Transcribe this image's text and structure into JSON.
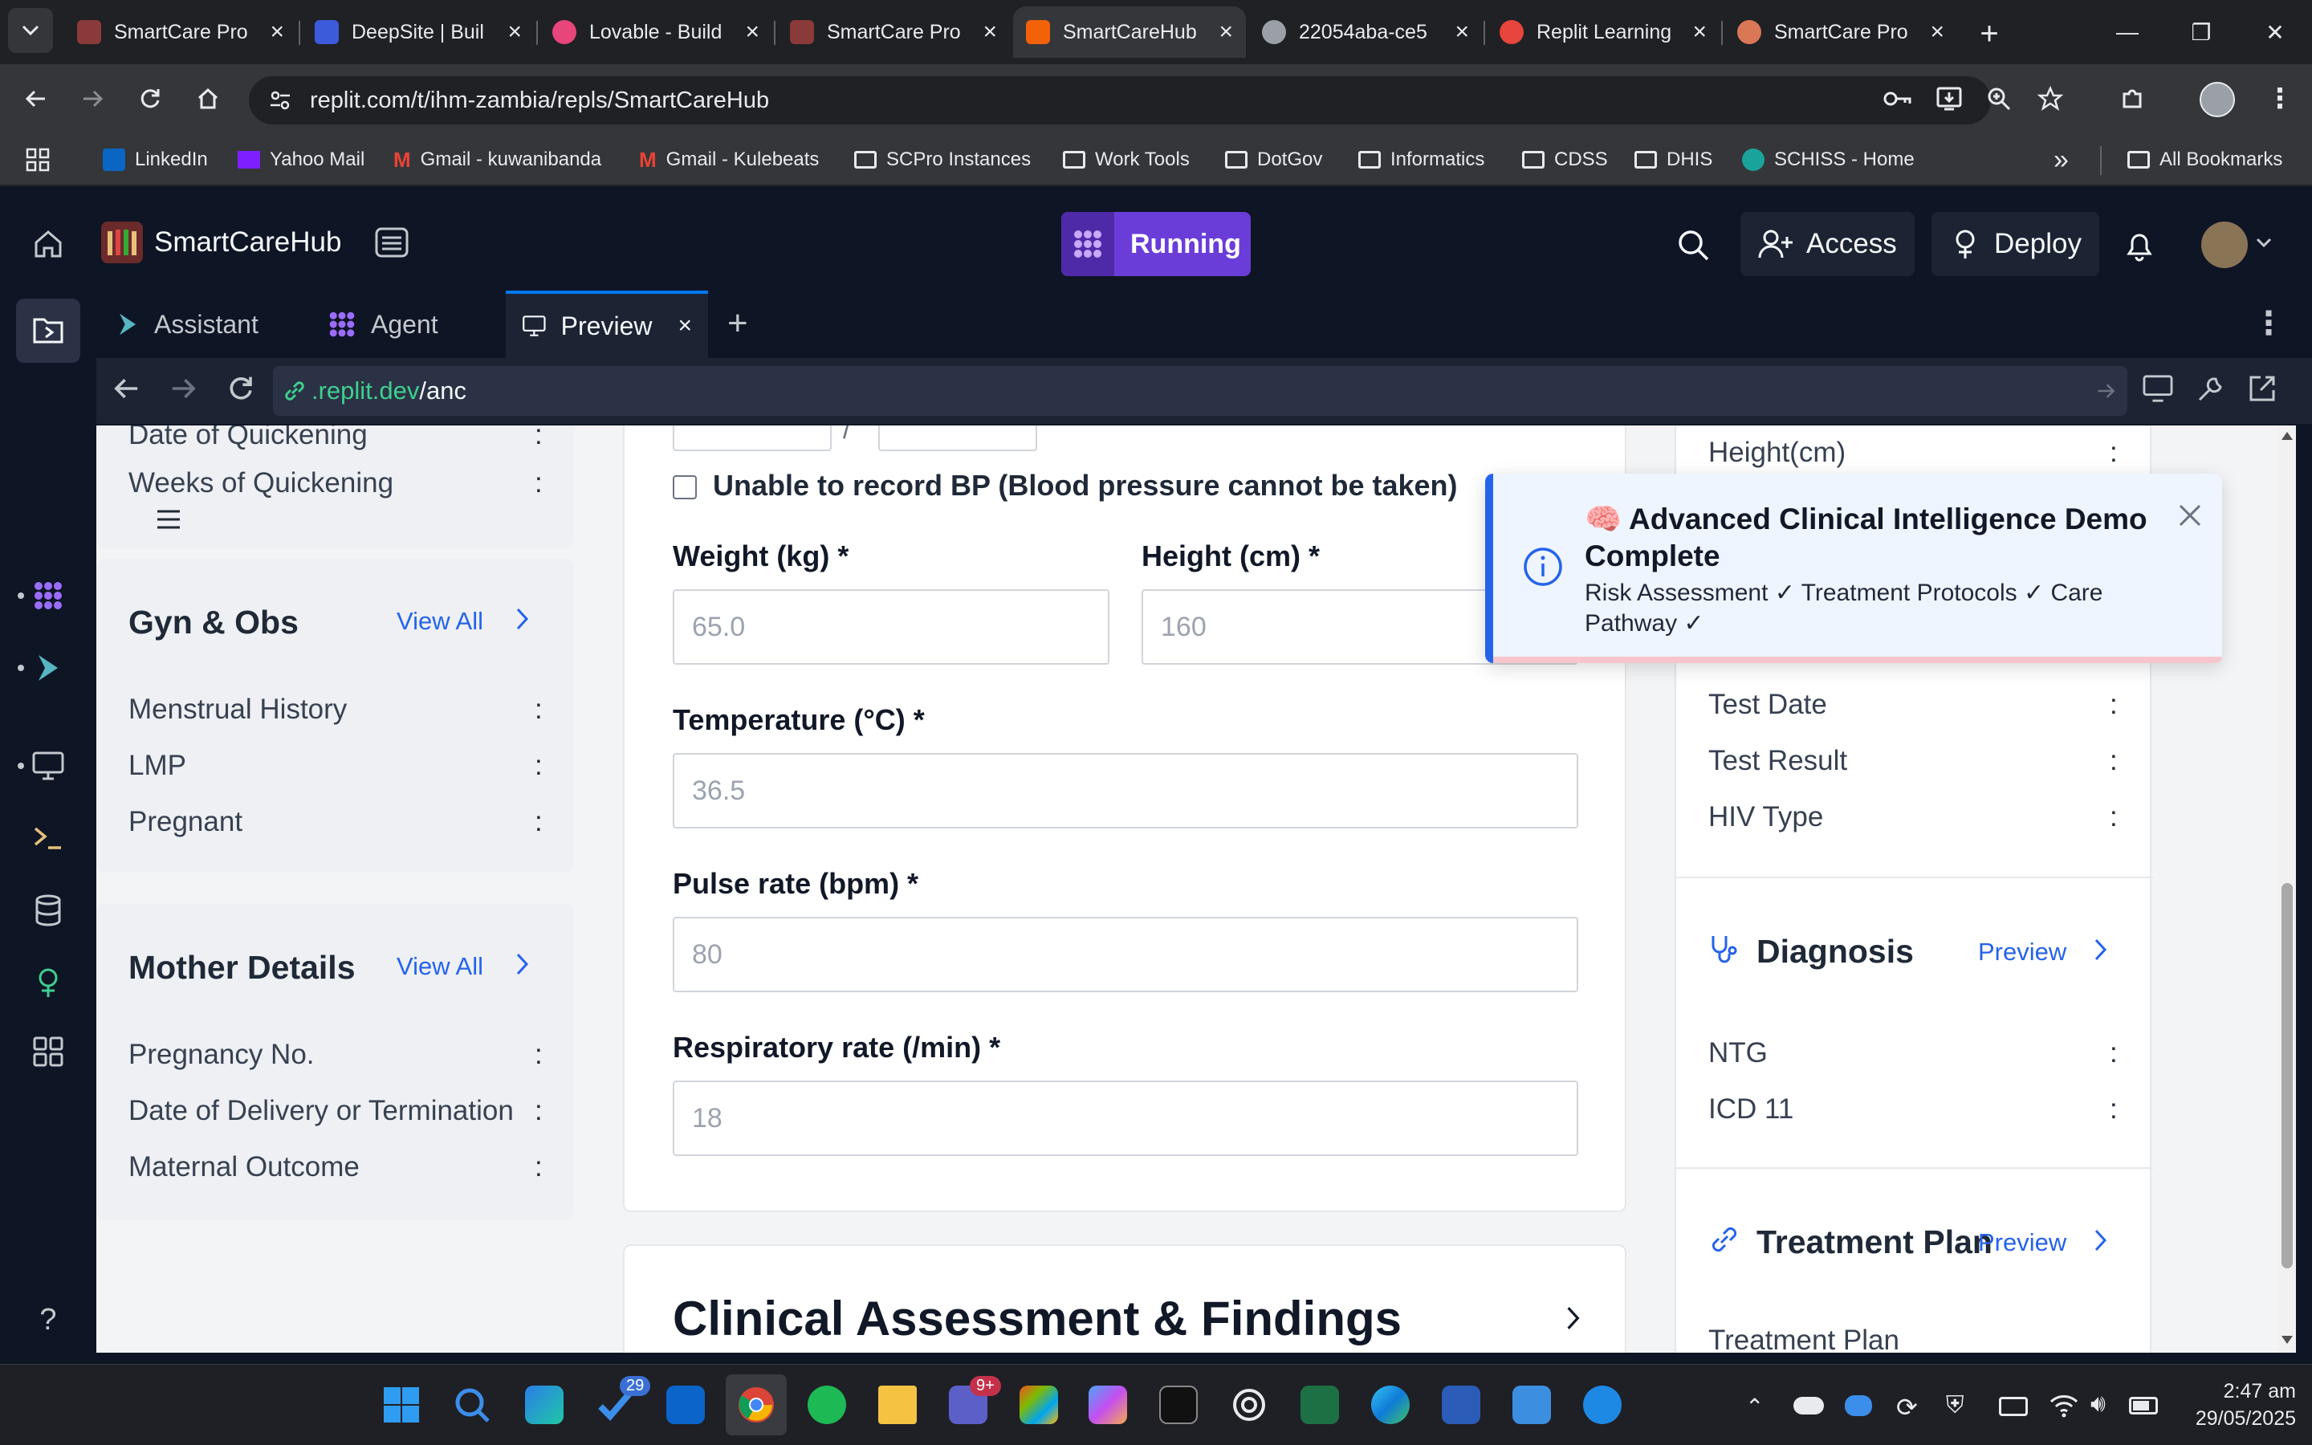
{
  "browser": {
    "tabs": [
      {
        "title": "SmartCare Pro",
        "color": "#8b3a3a"
      },
      {
        "title": "DeepSite | Buil",
        "color": "#3b5bdb"
      },
      {
        "title": "Lovable - Build",
        "color": "#e8457a"
      },
      {
        "title": "SmartCare Pro",
        "color": "#8b3a3a"
      },
      {
        "title": "SmartCareHub",
        "color": "#f26207",
        "active": true
      },
      {
        "title": "22054aba-ce5",
        "color": "#9aa0a6"
      },
      {
        "title": "Replit Learning",
        "color": "#e8453c"
      },
      {
        "title": "SmartCare Pro",
        "color": "#d97757"
      }
    ],
    "url": "replit.com/t/ihm-zambia/repls/SmartCareHub",
    "bookmarks": [
      "LinkedIn",
      "Yahoo Mail",
      "Gmail - kuwanibanda",
      "Gmail - Kulebeats",
      "SCPro Instances",
      "Work Tools",
      "DotGov",
      "Informatics",
      "CDSS",
      "DHIS",
      "SCHISS - Home"
    ],
    "all_bookmarks": "All Bookmarks",
    "more": "»"
  },
  "replit": {
    "project_name": "SmartCareHub",
    "run_label": "Running",
    "access_label": "Access",
    "deploy_label": "Deploy",
    "pane_tabs": {
      "assistant": "Assistant",
      "agent": "Agent",
      "preview": "Preview"
    },
    "preview_url_host": ".replit.dev",
    "preview_url_path": "/anc",
    "help": "?"
  },
  "app": {
    "left": {
      "top_items": [
        "Date of Quickening",
        "Weeks of Quickening"
      ],
      "gyn": {
        "title": "Gyn & Obs",
        "view_all": "View All",
        "items": [
          "Menstrual History",
          "LMP",
          "Pregnant"
        ]
      },
      "mother": {
        "title": "Mother Details",
        "view_all": "View All",
        "items": [
          "Pregnancy No.",
          "Date of Delivery or Termination",
          "Maternal Outcome"
        ]
      },
      "colon": ":"
    },
    "form": {
      "bp_slash": "/",
      "bp_checkbox_label": "Unable to record BP (Blood pressure cannot be taken)",
      "weight_label": "Weight (kg) *",
      "weight_placeholder": "65.0",
      "height_label": "Height (cm) *",
      "height_placeholder": "160",
      "temp_label": "Temperature (°C) *",
      "temp_placeholder": "36.5",
      "pulse_label": "Pulse rate (bpm) *",
      "pulse_placeholder": "80",
      "resp_label": "Respiratory rate (/min) *",
      "resp_placeholder": "18",
      "section_title": "Clinical Assessment & Findings"
    },
    "right": {
      "top_item": "Height(cm)",
      "hiv_items": [
        "Test Date",
        "Test Result",
        "HIV Type"
      ],
      "diagnosis": {
        "title": "Diagnosis",
        "link": "Preview",
        "items": [
          "NTG",
          "ICD 11"
        ]
      },
      "treatment": {
        "title": "Treatment Plan",
        "link": "Preview",
        "partial_item": "Treatment Plan"
      }
    },
    "toast": {
      "emoji": "🧠",
      "title": "Advanced Clinical Intelligence Demo Complete",
      "body": "Risk Assessment ✓ Treatment Protocols ✓ Care Pathway ✓"
    }
  },
  "taskbar": {
    "time": "2:47 am",
    "date": "29/05/2025",
    "badges": {
      "todo": "29",
      "teams": "9+"
    },
    "icons": [
      "start",
      "search",
      "ms365",
      "todo",
      "outlook",
      "chrome",
      "spotify",
      "file-explorer",
      "teams",
      "copilot",
      "copilot-alt",
      "perplexity",
      "chatgpt",
      "excel",
      "edge",
      "word",
      "paint",
      "snipping"
    ]
  }
}
